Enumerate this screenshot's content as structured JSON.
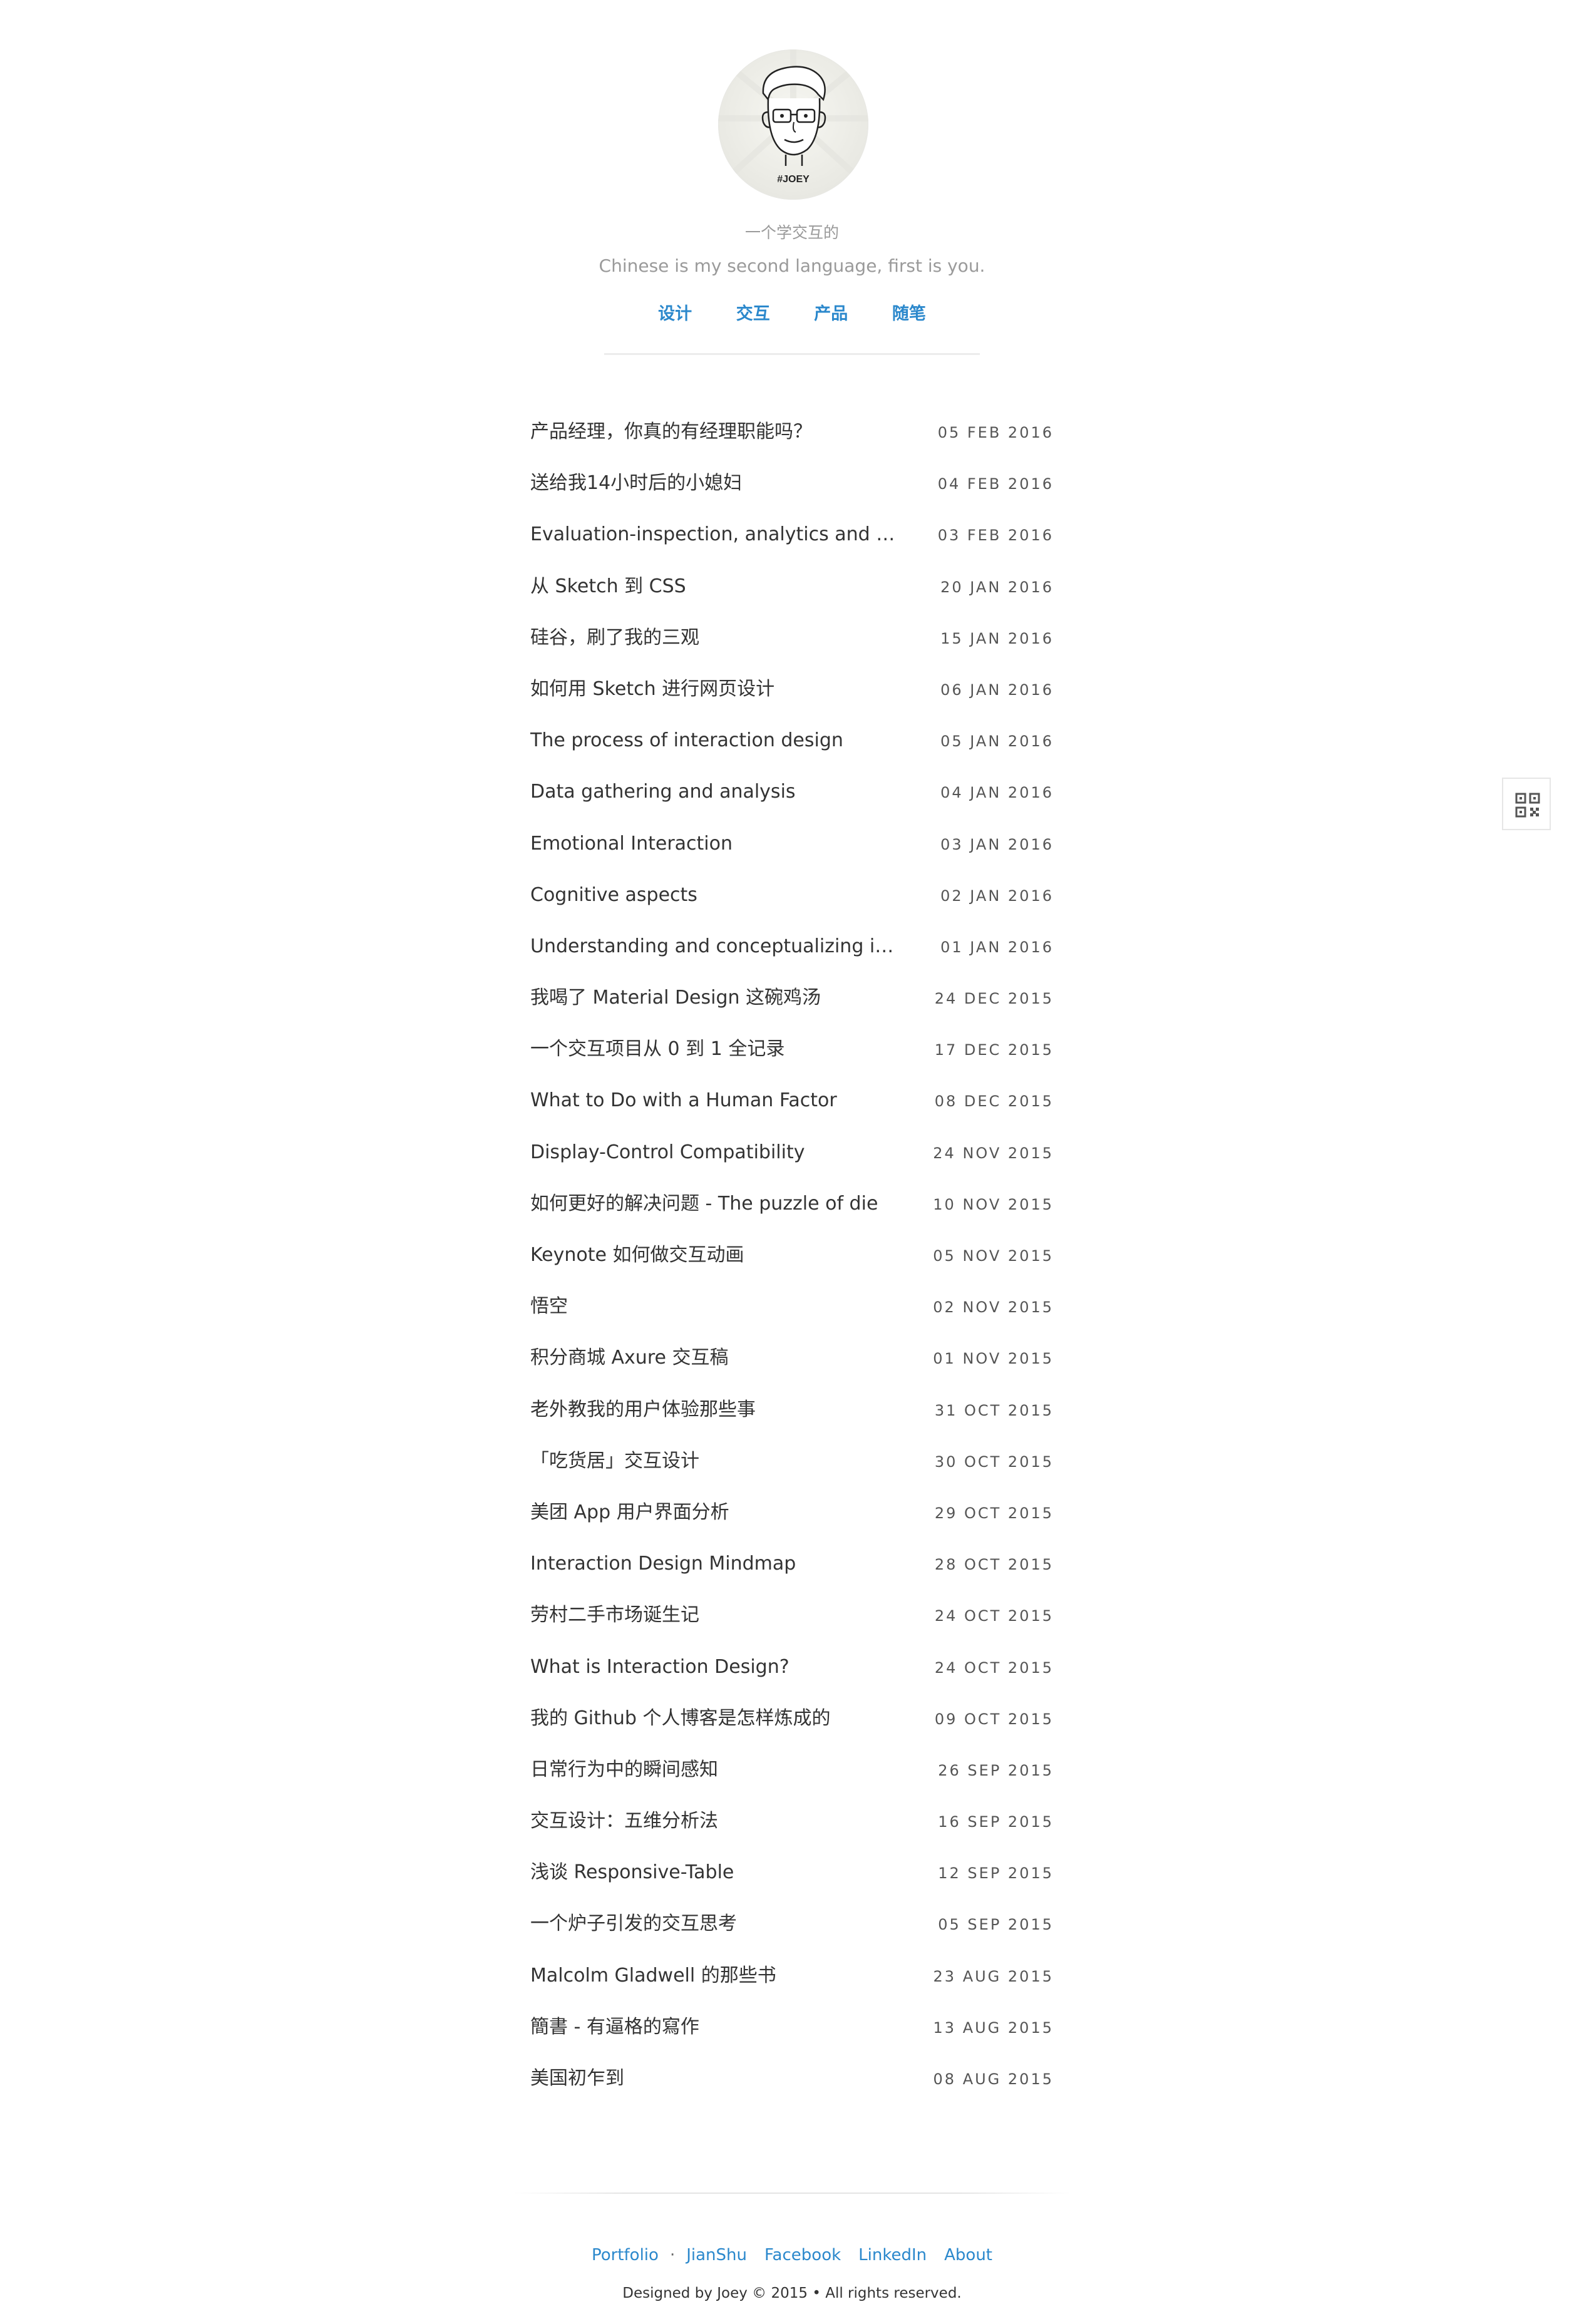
{
  "header": {
    "subtitle_cn": "一个学交互的",
    "subtitle_en": "Chinese is my second language, first is you.",
    "nav": [
      {
        "label": "设计"
      },
      {
        "label": "交互"
      },
      {
        "label": "产品"
      },
      {
        "label": "随笔"
      }
    ],
    "link_color": "#2b88cc",
    "muted_color": "#9a9a9a"
  },
  "posts": [
    {
      "title": "产品经理，你真的有经理职能吗？",
      "date": "05 FEB 2016"
    },
    {
      "title": "送给我14小时后的小媳妇",
      "date": "04 FEB 2016"
    },
    {
      "title": "Evaluation-inspection, analytics and models",
      "date": "03 FEB 2016"
    },
    {
      "title": "从 Sketch 到 CSS",
      "date": "20 JAN 2016"
    },
    {
      "title": "硅谷，刷了我的三观",
      "date": "15 JAN 2016"
    },
    {
      "title": "如何用 Sketch 进行网页设计",
      "date": "06 JAN 2016"
    },
    {
      "title": "The process of interaction design",
      "date": "05 JAN 2016"
    },
    {
      "title": "Data gathering and analysis",
      "date": "04 JAN 2016"
    },
    {
      "title": "Emotional Interaction",
      "date": "03 JAN 2016"
    },
    {
      "title": "Cognitive aspects",
      "date": "02 JAN 2016"
    },
    {
      "title": "Understanding and conceptualizing interaction",
      "date": "01 JAN 2016"
    },
    {
      "title": "我喝了 Material Design 这碗鸡汤",
      "date": "24 DEC 2015"
    },
    {
      "title": "一个交互项目从 0 到 1 全记录",
      "date": "17 DEC 2015"
    },
    {
      "title": "What to Do with a Human Factor",
      "date": "08 DEC 2015"
    },
    {
      "title": "Display-Control Compatibility",
      "date": "24 NOV 2015"
    },
    {
      "title": "如何更好的解决问题 - The puzzle of die",
      "date": "10 NOV 2015"
    },
    {
      "title": "Keynote 如何做交互动画",
      "date": "05 NOV 2015"
    },
    {
      "title": "悟空",
      "date": "02 NOV 2015"
    },
    {
      "title": "积分商城 Axure 交互稿",
      "date": "01 NOV 2015"
    },
    {
      "title": "老外教我的用户体验那些事",
      "date": "31 OCT 2015"
    },
    {
      "title": "「吃货居」交互设计",
      "date": "30 OCT 2015"
    },
    {
      "title": "美团 App 用户界面分析",
      "date": "29 OCT 2015"
    },
    {
      "title": "Interaction Design Mindmap",
      "date": "28 OCT 2015"
    },
    {
      "title": "劳村二手市场诞生记",
      "date": "24 OCT 2015"
    },
    {
      "title": "What is Interaction Design?",
      "date": "24 OCT 2015"
    },
    {
      "title": "我的 Github 个人博客是怎样炼成的",
      "date": "09 OCT 2015"
    },
    {
      "title": "日常行为中的瞬间感知",
      "date": "26 SEP 2015"
    },
    {
      "title": "交互设计：五维分析法",
      "date": "16 SEP 2015"
    },
    {
      "title": "浅谈 Responsive-Table",
      "date": "12 SEP 2015"
    },
    {
      "title": "一个炉子引发的交互思考",
      "date": "05 SEP 2015"
    },
    {
      "title": "Malcolm Gladwell 的那些书",
      "date": "23 AUG 2015"
    },
    {
      "title": "簡書 - 有逼格的寫作",
      "date": "13 AUG 2015"
    },
    {
      "title": "美国初乍到",
      "date": "08 AUG 2015"
    }
  ],
  "side": {
    "qr_icon": "qr-code-icon"
  },
  "footer": {
    "links": [
      {
        "label": "Portfolio"
      },
      {
        "label": "JianShu"
      },
      {
        "label": "Facebook"
      },
      {
        "label": "LinkedIn"
      },
      {
        "label": "About"
      }
    ],
    "separator": "·",
    "copyright": "Designed by Joey © 2015 • All rights reserved."
  }
}
